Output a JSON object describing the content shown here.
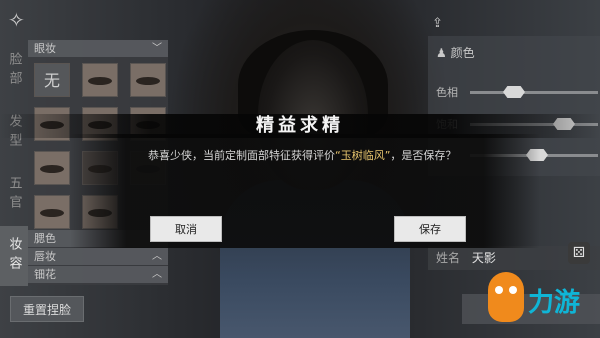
{
  "top": {
    "back_icon": "back-ornament-icon",
    "share_icon": "share-icon"
  },
  "side_tabs": [
    {
      "label": "脸部",
      "active": false
    },
    {
      "label": "发型",
      "active": false
    },
    {
      "label": "五官",
      "active": false
    },
    {
      "label": "妆容",
      "active": true
    }
  ],
  "left_panel": {
    "section": "眼妆",
    "none_label": "无",
    "categories": [
      "腮色",
      "唇妆",
      "钿花"
    ]
  },
  "reset_button": "重置捏脸",
  "right_panel": {
    "color_title": "颜色",
    "sliders": [
      {
        "label": "色相",
        "value": 0.35
      },
      {
        "label": "饱和",
        "value": 0.75
      },
      {
        "label": "",
        "value": 0.5
      }
    ],
    "name_label": "姓名",
    "name_value": "天影"
  },
  "dialog": {
    "title": "精益求精",
    "msg_prefix": "恭喜少侠，当前定制面部特征获得评价",
    "msg_highlight": "“玉树临风”",
    "msg_suffix": "，是否保存？",
    "cancel": "取消",
    "save": "保存"
  },
  "watermark": {
    "text": "力游"
  },
  "colors": {
    "highlight": "#e7c56e",
    "logo_orange": "#f08a1c",
    "logo_cyan": "#0fb5d6"
  }
}
